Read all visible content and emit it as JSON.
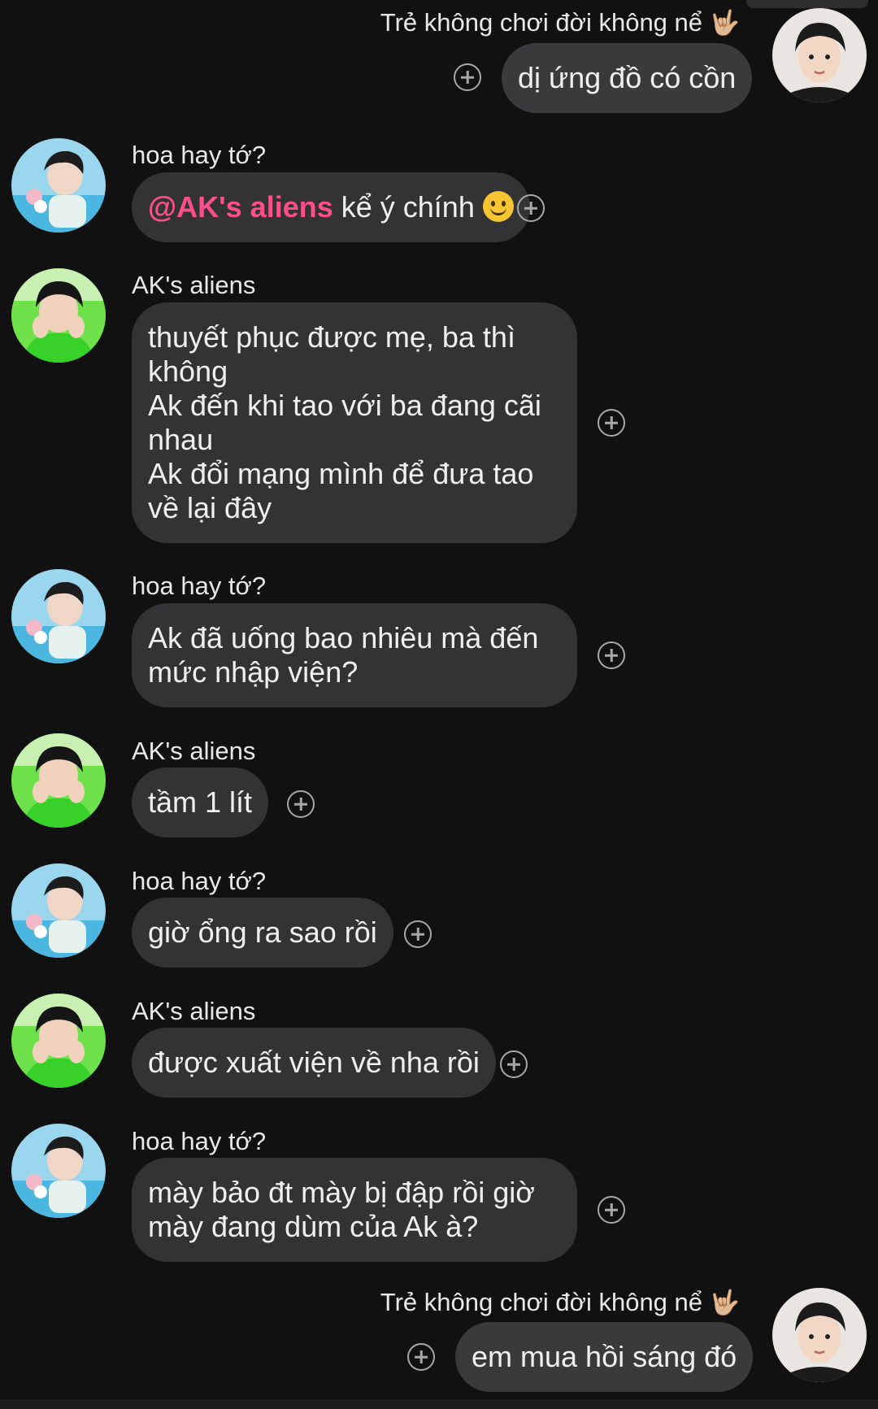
{
  "messages": [
    {
      "sender": "Trẻ không chơi đời không nể",
      "sender_emoji": "🤟🏼",
      "text": "dị ứng đồ có cồn",
      "direction": "outgoing"
    },
    {
      "sender": "hoa hay tớ?",
      "mention": "@AK's aliens",
      "text": " kể ý chính",
      "emoji": "smile-emoji",
      "direction": "incoming"
    },
    {
      "sender": "AK's aliens",
      "lines": [
        "thuyết phục được mẹ, ba thì không",
        "Ak đến khi tao với ba đang cãi nhau",
        "Ak đổi mạng mình để đưa tao về lại đây"
      ],
      "direction": "incoming"
    },
    {
      "sender": "hoa hay tớ?",
      "lines": [
        "Ak đã uống bao nhiêu mà đến mức nhập viện?"
      ],
      "direction": "incoming"
    },
    {
      "sender": "AK's aliens",
      "text": "tầm 1 lít",
      "direction": "incoming"
    },
    {
      "sender": "hoa hay tớ?",
      "text": "giờ ổng ra sao rồi",
      "direction": "incoming"
    },
    {
      "sender": "AK's aliens",
      "text": "được xuất viện về nha rồi",
      "direction": "incoming"
    },
    {
      "sender": "hoa hay tớ?",
      "lines": [
        "mày bảo đt mày bị đập rồi giờ mày đang dùm của Ak à?"
      ],
      "direction": "incoming"
    },
    {
      "sender": "Trẻ không chơi đời không nể",
      "sender_emoji": "🤟🏼",
      "text": "em mua hồi sáng đó",
      "direction": "outgoing"
    }
  ],
  "icons": {
    "react": "add-reaction-icon",
    "smile": "smile-emoji",
    "hand": "rock-on-hand-emoji"
  },
  "colors": {
    "background": "#111111",
    "bubble": "#333336",
    "mention": "#ff4f8b",
    "text": "#f0f0f0"
  }
}
